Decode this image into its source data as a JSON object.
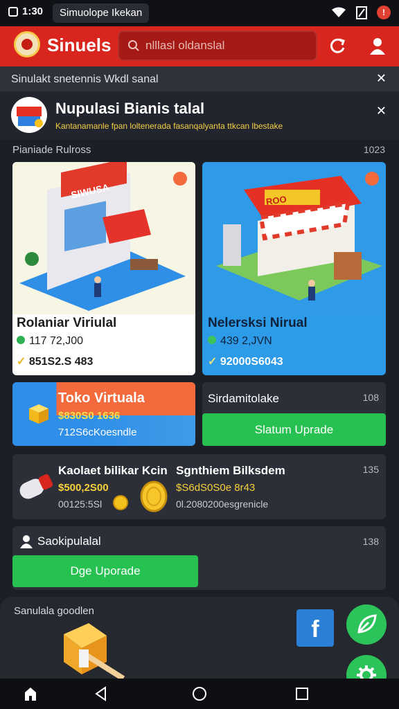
{
  "status_bar": {
    "time": "1:30",
    "chip": "Simuolope Ikekan"
  },
  "header": {
    "brand": "Sinuels",
    "search_placeholder": "nlllasl oldanslal"
  },
  "notice": {
    "text": "Sinulakt snetennis Wkdl sanal"
  },
  "banner": {
    "title": "Nupulasi Bianis talal",
    "subtitle": "Kantanamanle fpan loltenerada fasanqalyanta ttkcan lbestake"
  },
  "section": {
    "label": "Pianiade Rulross",
    "count": "1023"
  },
  "cards": [
    {
      "sign": "SIWUSA",
      "name": "Rolaniar Viriulal",
      "line2": "117 72,J00",
      "line3": "851S2.S 483"
    },
    {
      "sign": "ROO",
      "name": "Nelersksi Nirual",
      "line2": "439 2,JVN",
      "line3": "92000S6043"
    }
  ],
  "tile_toko": {
    "title": "Toko Virtuala",
    "value": "$830S0 1636",
    "sub": "712S6cKoesndle"
  },
  "tile_side": {
    "title": "Sirdamitolake",
    "count": "108",
    "button": "Slatum Uprade"
  },
  "tile_mid": {
    "left_title": "Kaolaet bilikar Kcin",
    "left_value": "$500,2S00",
    "left_sub": "00125:5Sl",
    "right_title": "Sgnthiem Bilksdem",
    "right_value": "$S6dS0S0e 8r43",
    "right_sub": "0l.2080200esgrenicle",
    "count": "135"
  },
  "tile_low": {
    "title": "Saokipulalal",
    "count": "138",
    "button": "Dge Uporade"
  },
  "bottom": {
    "label": "Sanulala goodlen",
    "fb_letter": "f"
  }
}
